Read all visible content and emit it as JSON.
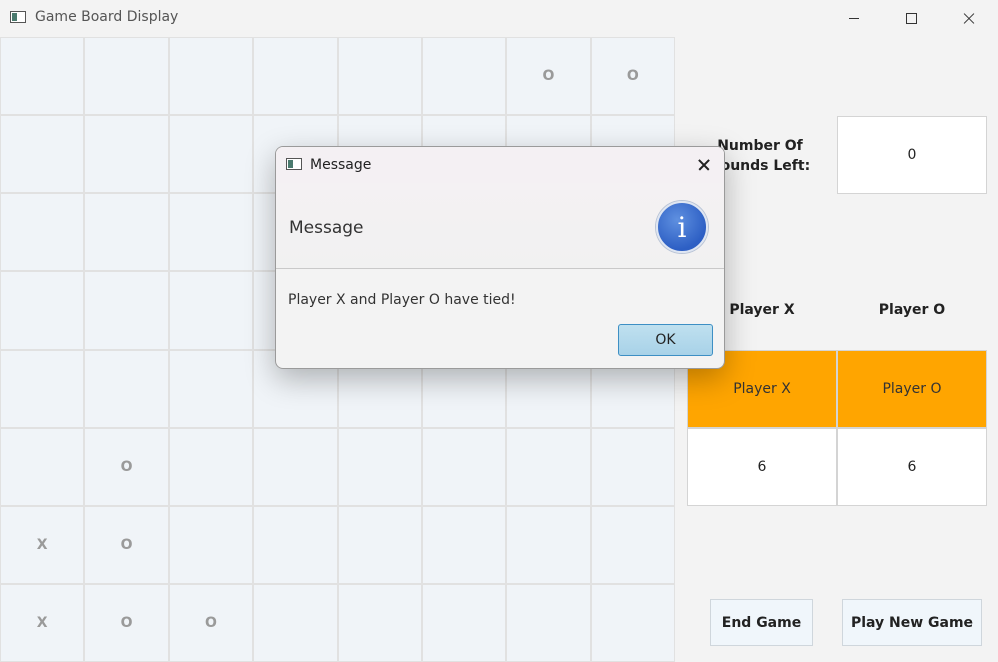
{
  "window": {
    "title": "Game Board Display",
    "icon": "app-window-icon"
  },
  "board": {
    "rows": [
      [
        "",
        "",
        "",
        "",
        "",
        "",
        "O",
        "O"
      ],
      [
        "",
        "",
        "",
        "",
        "",
        "",
        "",
        ""
      ],
      [
        "",
        "",
        "",
        "",
        "",
        "",
        "",
        ""
      ],
      [
        "",
        "",
        "",
        "",
        "",
        "",
        "",
        ""
      ],
      [
        "",
        "",
        "",
        "",
        "",
        "",
        "",
        ""
      ],
      [
        "",
        "O",
        "",
        "",
        "",
        "",
        "",
        ""
      ],
      [
        "X",
        "O",
        "",
        "",
        "",
        "",
        "",
        ""
      ],
      [
        "X",
        "O",
        "O",
        "",
        "",
        "",
        "",
        ""
      ]
    ]
  },
  "rounds": {
    "label": "Number Of Rounds Left:",
    "value": "0"
  },
  "players": {
    "x": {
      "header": "Player X",
      "name": "Player X",
      "score": "6"
    },
    "o": {
      "header": "Player O",
      "name": "Player O",
      "score": "6"
    }
  },
  "actions": {
    "end_game": "End Game",
    "play_new_game": "Play New Game"
  },
  "dialog": {
    "title": "Message",
    "header": "Message",
    "content": "Player X and Player O have tied!",
    "ok": "OK",
    "info_icon_glyph": "i"
  },
  "colors": {
    "player_name_bg": "#ffa500",
    "board_cell_bg": "#f0f4f8",
    "ok_button_bg": "#a8d2e8"
  }
}
